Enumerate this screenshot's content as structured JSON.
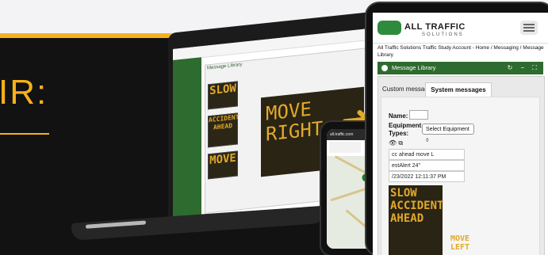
{
  "page": {
    "heading": "IR:"
  },
  "laptop": {
    "window_title": "Message Library",
    "big_sign_lines": [
      "MOVE",
      "RIGHT"
    ],
    "preview1": "SLOW",
    "preview2": "ACCIDENT AHEAD",
    "preview3": "MOVE"
  },
  "phone": {
    "status": "all.traffic.com"
  },
  "tablet": {
    "brand": "ALL TRAFFIC",
    "brand_sub": "SOLUTIONS",
    "breadcrumb": "All Traffic Solutions Traffic Study Account - Home / Messaging / Message Library",
    "library_title": "Message Library",
    "tabs": [
      "Custom messages",
      "System messages"
    ],
    "name_label": "Name:",
    "equipment_label": "Equipment Types:",
    "equipment_select": "Select Equipment ◊",
    "rows": [
      "cc ahead move L",
      "estAlert 24\"",
      "/23/2022 12:11:37 PM"
    ],
    "sign_lines": [
      "SLOW",
      "ACCIDENT",
      "AHEAD"
    ],
    "move_lines": [
      "MOVE",
      "LEFT"
    ]
  }
}
